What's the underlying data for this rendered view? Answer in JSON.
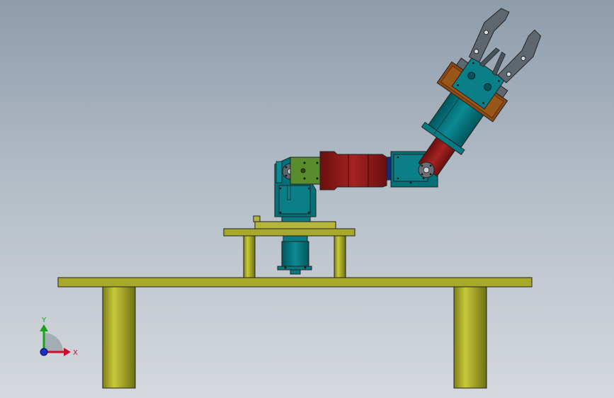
{
  "viewport": {
    "colors": {
      "bg_top": "#8e9cab",
      "bg_bottom": "#d5d9de",
      "table": "#a8a82a",
      "table_dark": "#7f7f1a",
      "teal": "#00707a",
      "teal_dark": "#00555c",
      "green": "#5a8c2e",
      "red": "#8a1a1a",
      "red_dark": "#6a0f0f",
      "brown": "#8a4a12",
      "gripper": "#5e6670",
      "edge": "#1a1a1a"
    }
  },
  "triad": {
    "x_label": "X",
    "y_label": "Y",
    "x_color": "#c8102e",
    "y_color": "#1aa31a",
    "z_color": "#1a2fc8"
  }
}
